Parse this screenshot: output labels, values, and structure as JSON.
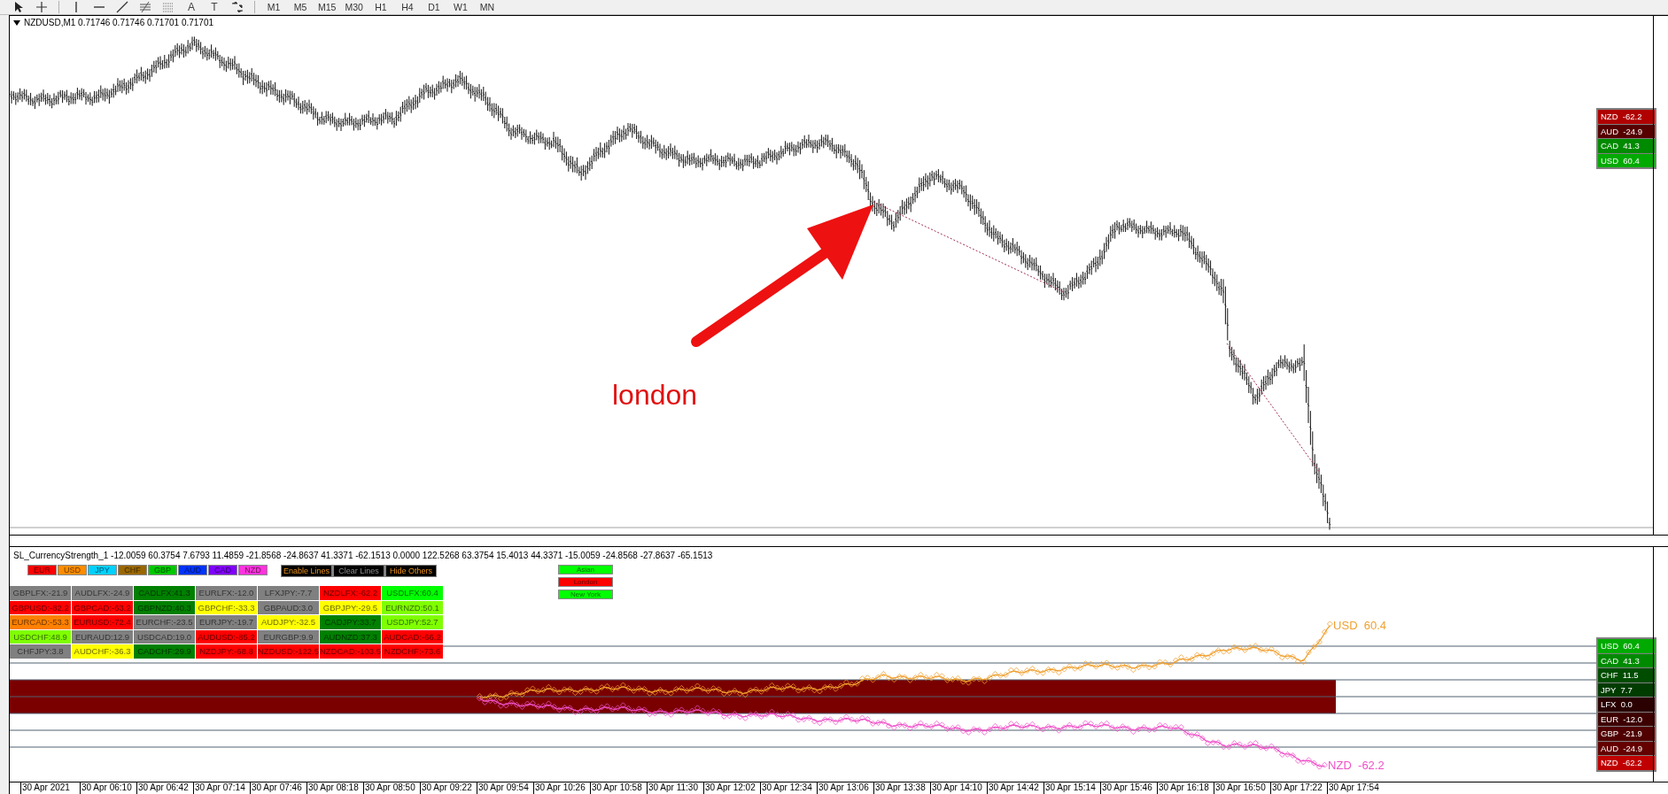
{
  "toolbar": {
    "text_tool": "A",
    "label_tool": "T",
    "timeframes": [
      "M1",
      "M5",
      "M15",
      "M30",
      "H1",
      "H4",
      "D1",
      "W1",
      "MN"
    ]
  },
  "main_chart": {
    "title": "NZDUSD,M1  0.71746 0.71746 0.71701 0.71701",
    "annotation": "london",
    "strength_panel": [
      {
        "label": "NZD  -62.2",
        "color": "#b00000"
      },
      {
        "label": "AUD  -24.9",
        "color": "#560000"
      },
      {
        "label": "CAD  41.3",
        "color": "#008a00"
      },
      {
        "label": "USD  60.4",
        "color": "#00aa00"
      }
    ]
  },
  "indicator": {
    "header": "SL_CurrencyStrength_1 -12.0059 60.3754 7.6793 11.4859 -21.8568 -24.8637 41.3371 -62.1513 0.0000 122.5268 63.3754 15.4013 44.3371 -15.0059 -24.8568 -27.8637 -65.1513",
    "currency_buttons": [
      {
        "label": "EUR",
        "color": "#ff0000"
      },
      {
        "label": "USD",
        "color": "#ff8c00"
      },
      {
        "label": "JPY",
        "color": "#00d0ff"
      },
      {
        "label": "CHF",
        "color": "#996600"
      },
      {
        "label": "GBP",
        "color": "#00c800"
      },
      {
        "label": "AUD",
        "color": "#0033ff"
      },
      {
        "label": "CAD",
        "color": "#8000ff"
      },
      {
        "label": "NZD",
        "color": "#ff33dd"
      }
    ],
    "line_buttons": [
      {
        "label": "Enable Lines",
        "disabled": false
      },
      {
        "label": "Clear Lines",
        "disabled": true
      },
      {
        "label": "Hide Others",
        "disabled": false
      }
    ],
    "session_buttons": [
      {
        "label": "Asian",
        "color": "#00ff00"
      },
      {
        "label": "London",
        "color": "#ff0000"
      },
      {
        "label": "New York",
        "color": "#00ff00"
      }
    ],
    "pairs": [
      [
        {
          "label": "GBPLFX:-21.9",
          "color": "#808080"
        },
        {
          "label": "AUDLFX:-24.9",
          "color": "#808080"
        },
        {
          "label": "CADLFX:41.3",
          "color": "#008000"
        },
        {
          "label": "EURLFX:-12.0",
          "color": "#808080"
        },
        {
          "label": "LFXJPY:-7.7",
          "color": "#808080"
        },
        {
          "label": "NZDLFX:-62.2",
          "color": "#ff0000"
        },
        {
          "label": "USDLFX:60.4",
          "color": "#00ff00"
        }
      ],
      [
        {
          "label": "GBPUSD:-82.2",
          "color": "#ff0000"
        },
        {
          "label": "GBPCAD:-63.2",
          "color": "#ff0000"
        },
        {
          "label": "GBPNZD:40.3",
          "color": "#008000"
        },
        {
          "label": "GBPCHF:-33.3",
          "color": "#ffff00"
        },
        {
          "label": "GBPAUD:3.0",
          "color": "#808080"
        },
        {
          "label": "GBPJPY:-29.5",
          "color": "#ffff00"
        },
        {
          "label": "EURNZD:50.1",
          "color": "#7fff00"
        }
      ],
      [
        {
          "label": "EURCAD:-53.3",
          "color": "#ff8000"
        },
        {
          "label": "EURUSD:-72.4",
          "color": "#ff0000"
        },
        {
          "label": "EURCHF:-23.5",
          "color": "#808080"
        },
        {
          "label": "EURJPY:-19.7",
          "color": "#808080"
        },
        {
          "label": "AUDJPY:-32.5",
          "color": "#ffff00"
        },
        {
          "label": "CADJPY:33.7",
          "color": "#008000"
        },
        {
          "label": "USDJPY:52.7",
          "color": "#7fff00"
        }
      ],
      [
        {
          "label": "USDCHF:48.9",
          "color": "#7fff00"
        },
        {
          "label": "EURAUD:12.9",
          "color": "#808080"
        },
        {
          "label": "USDCAD:19.0",
          "color": "#808080"
        },
        {
          "label": "AUDUSD:-85.2",
          "color": "#ff0000"
        },
        {
          "label": "EURGBP:9.9",
          "color": "#808080"
        },
        {
          "label": "AUDNZD:37.3",
          "color": "#008000"
        },
        {
          "label": "AUDCAD:-66.2",
          "color": "#ff0000"
        }
      ],
      [
        {
          "label": "CHFJPY:3.8",
          "color": "#808080"
        },
        {
          "label": "AUDCHF:-36.3",
          "color": "#ffff00"
        },
        {
          "label": "CADCHF:29.9",
          "color": "#008000"
        },
        {
          "label": "NZDJPY:-68.8",
          "color": "#ff0000"
        },
        {
          "label": "NZDUSD:-122.5",
          "color": "#ff0000"
        },
        {
          "label": "NZDCAD:-103.5",
          "color": "#ff0000"
        },
        {
          "label": "NZDCHF:-73.6",
          "color": "#ff0000"
        }
      ]
    ],
    "strength_lines": [
      {
        "label": "USD  60.4",
        "color": "#f0a030"
      },
      {
        "label": "NZD  -62.2",
        "color": "#f050c8"
      }
    ],
    "strength_list": [
      {
        "label": "USD  60.4",
        "color": "#00aa00"
      },
      {
        "label": "CAD  41.3",
        "color": "#008a00"
      },
      {
        "label": "CHF  11.5",
        "color": "#004d00"
      },
      {
        "label": "JPY  7.7",
        "color": "#003c00"
      },
      {
        "label": "LFX  0.0",
        "color": "#2a0000"
      },
      {
        "label": "EUR  -12.0",
        "color": "#3d0000"
      },
      {
        "label": "GBP  -21.9",
        "color": "#500000"
      },
      {
        "label": "AUD  -24.9",
        "color": "#640000"
      },
      {
        "label": "NZD  -62.2",
        "color": "#c00000"
      }
    ]
  },
  "time_axis": [
    "30 Apr 2021",
    "30 Apr 06:10",
    "30 Apr 06:42",
    "30 Apr 07:14",
    "30 Apr 07:46",
    "30 Apr 08:18",
    "30 Apr 08:50",
    "30 Apr 09:22",
    "30 Apr 09:54",
    "30 Apr 10:26",
    "30 Apr 10:58",
    "30 Apr 11:30",
    "30 Apr 12:02",
    "30 Apr 12:34",
    "30 Apr 13:06",
    "30 Apr 13:38",
    "30 Apr 14:10",
    "30 Apr 14:42",
    "30 Apr 15:14",
    "30 Apr 15:46",
    "30 Apr 16:18",
    "30 Apr 16:50",
    "30 Apr 17:22",
    "30 Apr 17:54"
  ]
}
